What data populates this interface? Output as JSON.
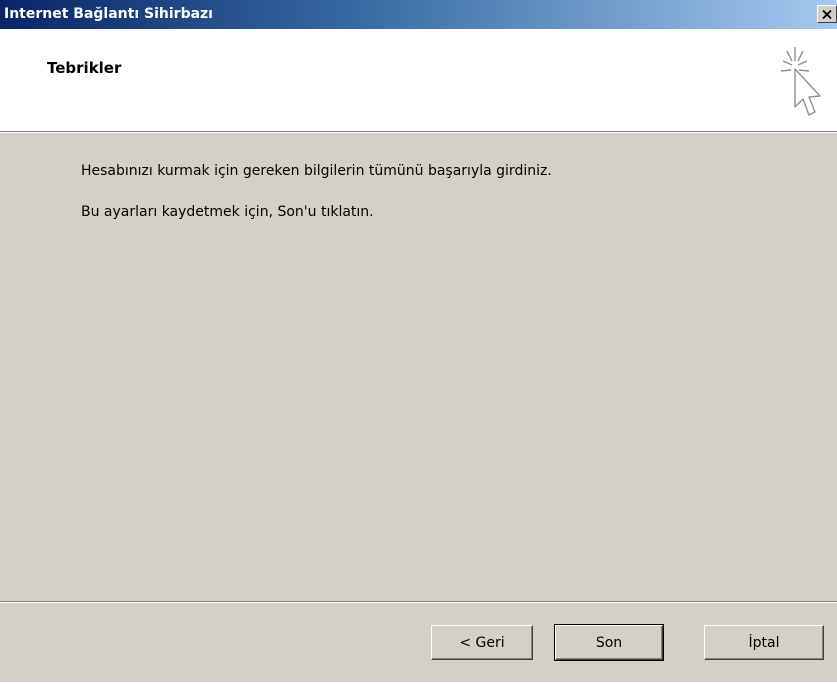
{
  "window": {
    "title": "Internet Bağlantı Sihirbazı",
    "close_label": "✕"
  },
  "header": {
    "title": "Tebrikler",
    "icon": "wizard-cursor-sparkle-icon"
  },
  "content": {
    "line1": "Hesabınızı kurmak için gereken bilgilerin tümünü başarıyla girdiniz.",
    "line2": "Bu ayarları kaydetmek için, Son'u tıklatın."
  },
  "buttons": {
    "back_label": "< Geri",
    "finish_label": "Son",
    "cancel_label": "İptal"
  },
  "colors": {
    "titlebar_start": "#0a246a",
    "titlebar_end": "#a6caf0",
    "dialog_face": "#d4d0c8",
    "header_bg": "#ffffff"
  }
}
